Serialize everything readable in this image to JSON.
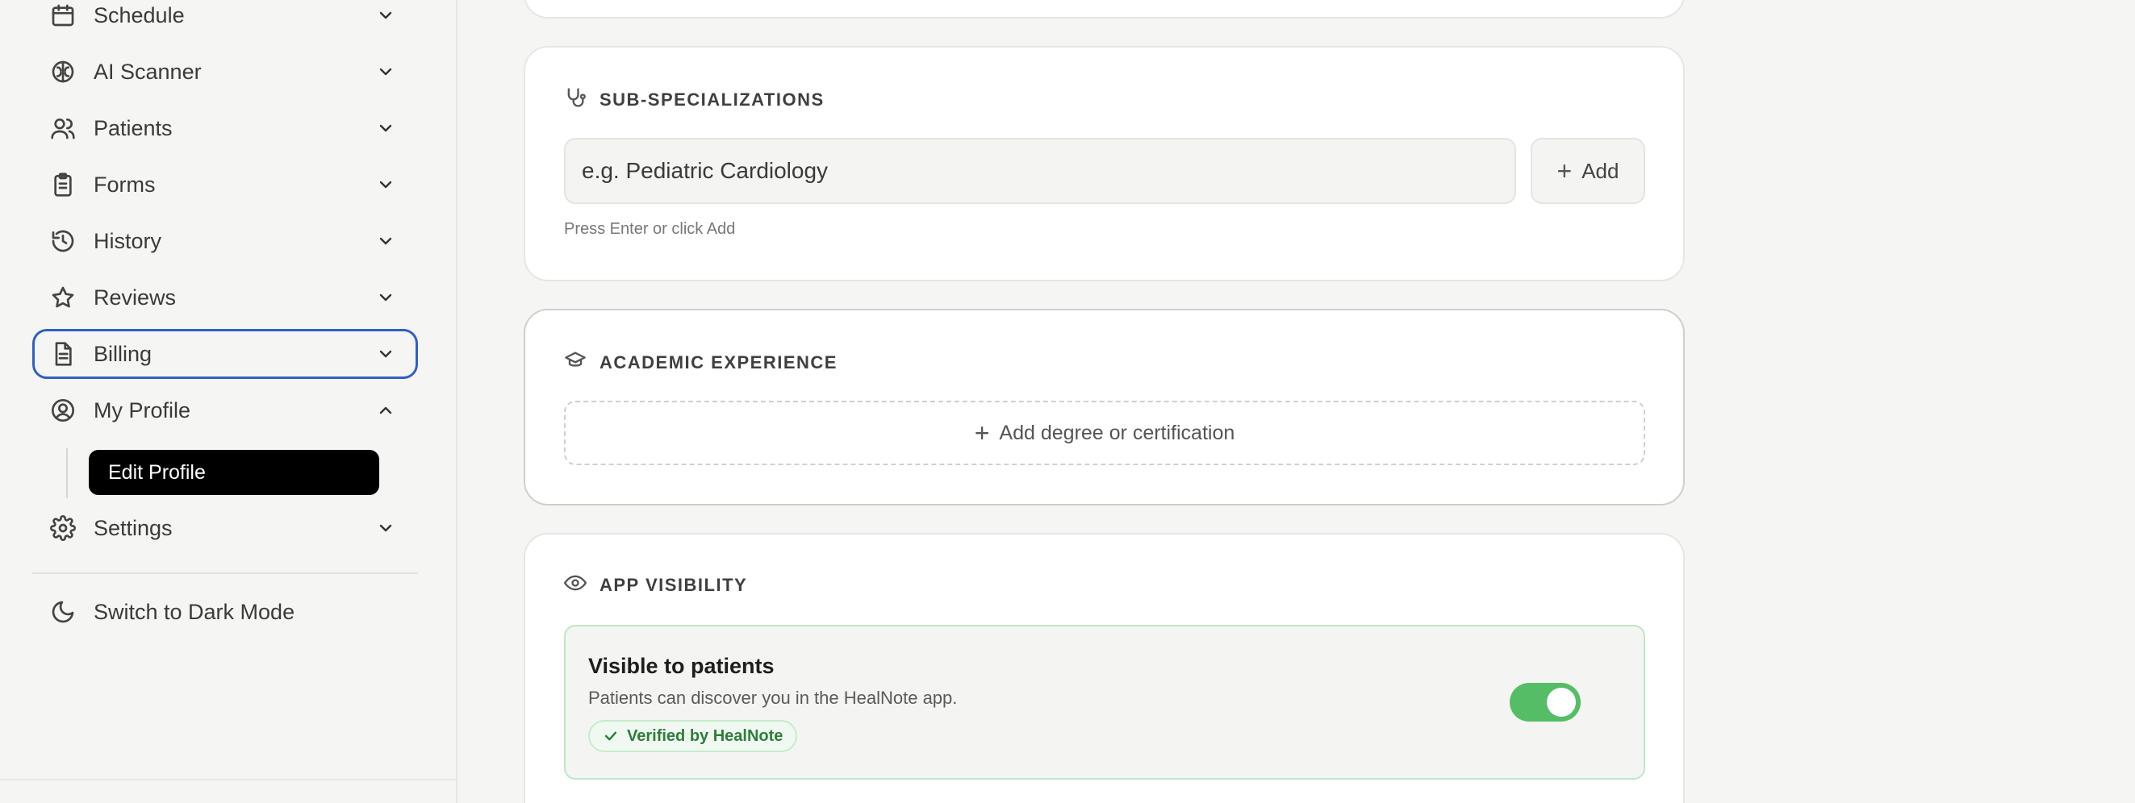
{
  "sidebar": {
    "items": [
      {
        "label": "Schedule",
        "icon": "calendar-icon",
        "expanded": false
      },
      {
        "label": "AI Scanner",
        "icon": "brain-icon",
        "expanded": false
      },
      {
        "label": "Patients",
        "icon": "users-icon",
        "expanded": false
      },
      {
        "label": "Forms",
        "icon": "clipboard-icon",
        "expanded": false
      },
      {
        "label": "History",
        "icon": "history-icon",
        "expanded": false
      },
      {
        "label": "Reviews",
        "icon": "star-icon",
        "expanded": false
      },
      {
        "label": "Billing",
        "icon": "document-icon",
        "expanded": false,
        "focused": true
      },
      {
        "label": "My Profile",
        "icon": "user-circle-icon",
        "expanded": true
      },
      {
        "label": "Settings",
        "icon": "gear-icon",
        "expanded": false
      }
    ],
    "sub_items": [
      {
        "label": "Edit Profile",
        "active": true
      }
    ],
    "dark_mode_label": "Switch to Dark Mode"
  },
  "sub_specializations": {
    "title": "SUB-SPECIALIZATIONS",
    "placeholder": "e.g. Pediatric Cardiology",
    "add_label": "Add",
    "hint": "Press Enter or click Add"
  },
  "academic_experience": {
    "title": "ACADEMIC EXPERIENCE",
    "add_label": "Add degree or certification"
  },
  "app_visibility": {
    "title": "APP VISIBILITY",
    "heading": "Visible to patients",
    "description": "Patients can discover you in the HealNote app.",
    "badge": "Verified by HealNote",
    "enabled": true
  },
  "colors": {
    "focus_ring": "#2f5fc8",
    "toggle_on": "#55bd66",
    "badge_text": "#2f7d3b",
    "active_sub_item": "#000000"
  }
}
